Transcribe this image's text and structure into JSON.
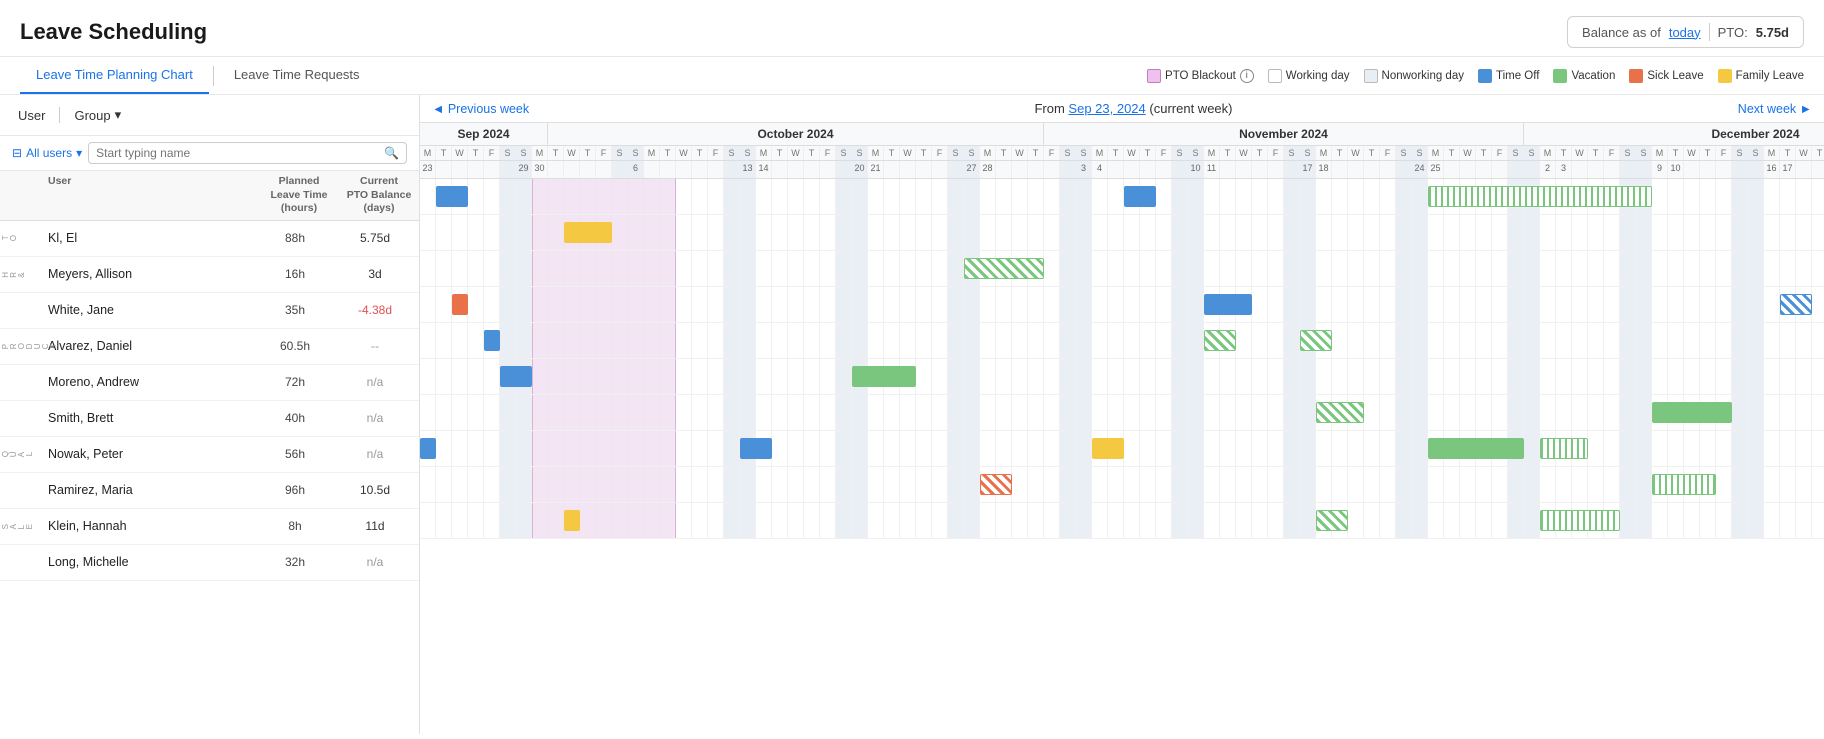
{
  "app": {
    "title": "Leave Scheduling",
    "balance_label": "Balance as of",
    "today_link": "today",
    "pto_label": "PTO:",
    "pto_value": "5.75d"
  },
  "tabs": [
    {
      "id": "planning",
      "label": "Leave Time Planning Chart",
      "active": true
    },
    {
      "id": "requests",
      "label": "Leave Time Requests",
      "active": false
    }
  ],
  "legend": [
    {
      "id": "pto-blackout",
      "label": "PTO Blackout",
      "has_info": true
    },
    {
      "id": "working",
      "label": "Working day"
    },
    {
      "id": "nonworking",
      "label": "Nonworking day"
    },
    {
      "id": "timeoff",
      "label": "Time Off"
    },
    {
      "id": "vacation",
      "label": "Vacation"
    },
    {
      "id": "sick",
      "label": "Sick Leave"
    },
    {
      "id": "family",
      "label": "Family Leave"
    }
  ],
  "controls": {
    "user_label": "User",
    "group_label": "Group",
    "filter_label": "All users",
    "search_placeholder": "Start typing name"
  },
  "column_headers": {
    "name": "User",
    "planned": "Planned Leave Time (hours)",
    "pto": "Current PTO Balance (days)"
  },
  "nav": {
    "prev": "◄ Previous week",
    "next": "Next week ►",
    "from_label": "From",
    "from_date": "Sep 23, 2024",
    "from_suffix": "(current week)"
  },
  "users": [
    {
      "dept": "T\nO",
      "name": "Kl, El",
      "planned": "88h",
      "pto": "5.75d",
      "pto_class": "pto-positive"
    },
    {
      "dept": "H\nR\n&",
      "name": "Meyers, Allison",
      "planned": "16h",
      "pto": "3d",
      "pto_class": "pto-positive"
    },
    {
      "dept": "",
      "name": "White, Jane",
      "planned": "35h",
      "pto": "-4.38d",
      "pto_class": "pto-negative"
    },
    {
      "dept": "P\nR\nO\nD\nU\nC\nT",
      "name": "Alvarez, Daniel",
      "planned": "60.5h",
      "pto": "--",
      "pto_class": "pto-dashes"
    },
    {
      "dept": "",
      "name": "Moreno, Andrew",
      "planned": "72h",
      "pto": "n/a",
      "pto_class": "pto-na"
    },
    {
      "dept": "",
      "name": "Smith, Brett",
      "planned": "40h",
      "pto": "n/a",
      "pto_class": "pto-na"
    },
    {
      "dept": "Q\nU\nA\nL",
      "name": "Nowak, Peter",
      "planned": "56h",
      "pto": "n/a",
      "pto_class": "pto-na"
    },
    {
      "dept": "",
      "name": "Ramirez, Maria",
      "planned": "96h",
      "pto": "10.5d",
      "pto_class": "pto-positive"
    },
    {
      "dept": "S\nA\nL\nE",
      "name": "Klein, Hannah",
      "planned": "8h",
      "pto": "11d",
      "pto_class": "pto-positive"
    },
    {
      "dept": "",
      "name": "Long, Michelle",
      "planned": "32h",
      "pto": "n/a",
      "pto_class": "pto-na"
    }
  ]
}
